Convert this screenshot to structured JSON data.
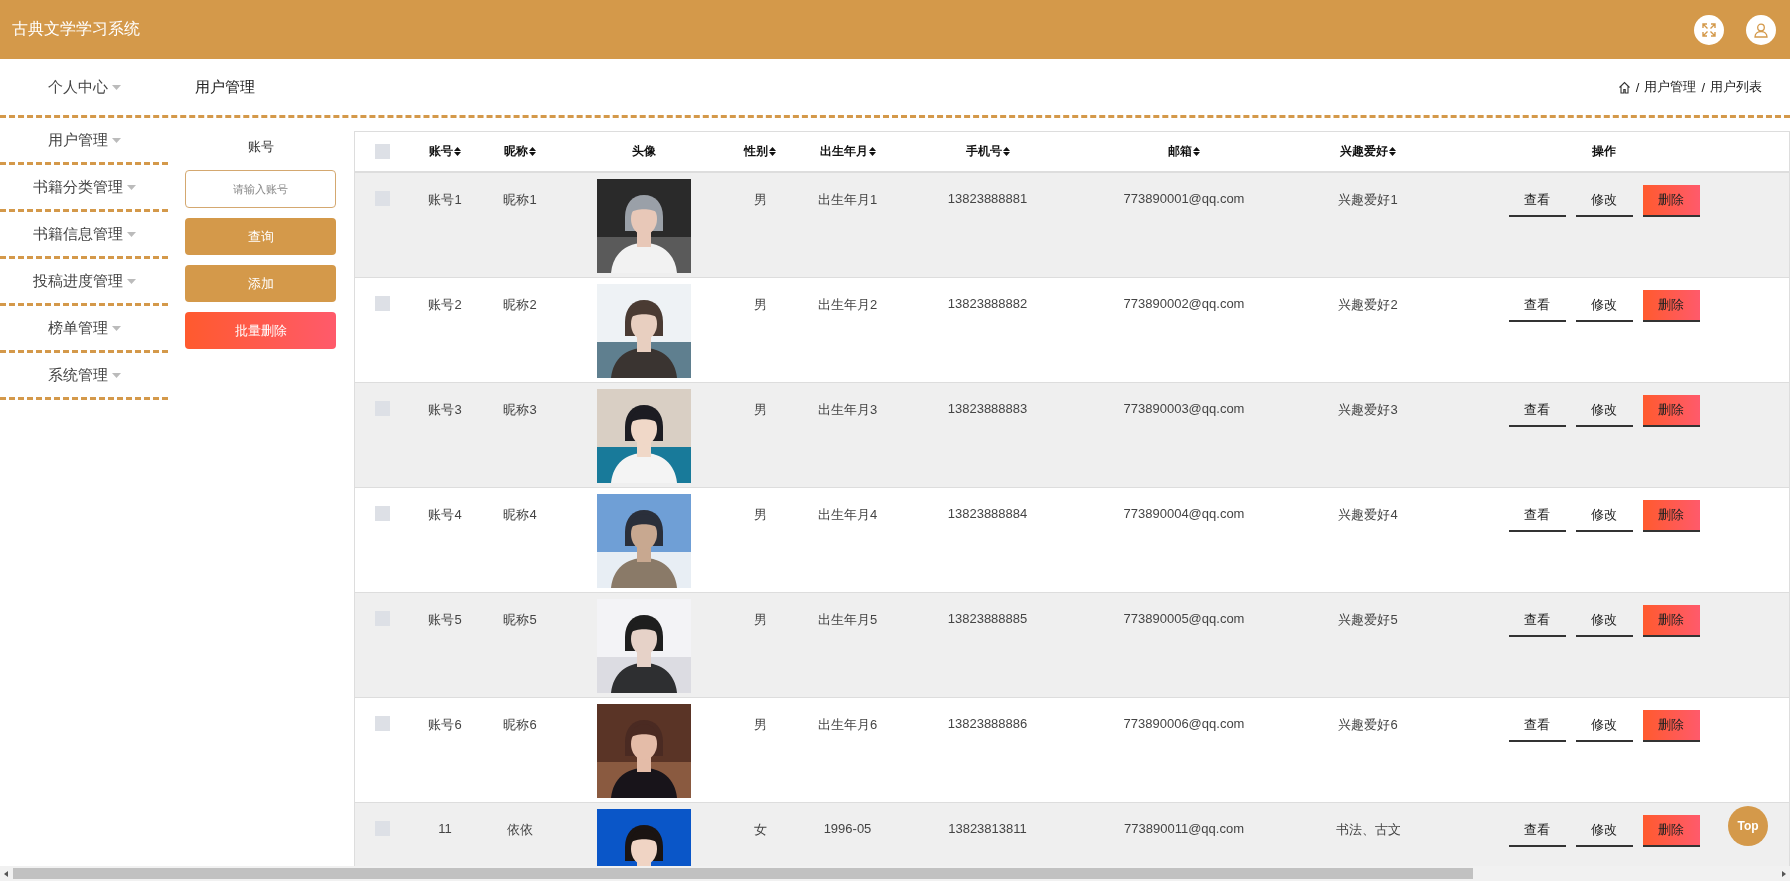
{
  "header": {
    "title": "古典文学学习系统"
  },
  "sidebar": {
    "items": [
      {
        "label": "个人中心"
      },
      {
        "label": "用户管理"
      },
      {
        "label": "书籍分类管理"
      },
      {
        "label": "书籍信息管理"
      },
      {
        "label": "投稿进度管理"
      },
      {
        "label": "榜单管理"
      },
      {
        "label": "系统管理"
      }
    ]
  },
  "page_title": "用户管理",
  "breadcrumb": {
    "separator": "/",
    "items": [
      "用户管理",
      "用户列表"
    ]
  },
  "search": {
    "label": "账号",
    "placeholder": "请输入账号",
    "buttons": [
      {
        "label": "查询",
        "kind": "primary"
      },
      {
        "label": "添加",
        "kind": "primary"
      },
      {
        "label": "批量删除",
        "kind": "danger"
      }
    ]
  },
  "table": {
    "all_checked": false,
    "columns": [
      {
        "label": "账号",
        "sortable": true
      },
      {
        "label": "昵称",
        "sortable": true
      },
      {
        "label": "头像",
        "sortable": false
      },
      {
        "label": "性别",
        "sortable": true
      },
      {
        "label": "出生年月",
        "sortable": true
      },
      {
        "label": "手机号",
        "sortable": true
      },
      {
        "label": "邮箱",
        "sortable": true
      },
      {
        "label": "兴趣爱好",
        "sortable": true
      },
      {
        "label": "操作",
        "sortable": false
      }
    ],
    "rows": [
      {
        "checked": false,
        "account": "账号1",
        "nickname": "昵称1",
        "gender": "男",
        "birth": "出生年月1",
        "phone": "13823888881",
        "email": "773890001@qq.com",
        "hobby": "兴趣爱好1",
        "actions": [
          {
            "label": "查看",
            "kind": "view"
          },
          {
            "label": "修改",
            "kind": "edit"
          },
          {
            "label": "删除",
            "kind": "delete"
          }
        ]
      },
      {
        "checked": false,
        "account": "账号2",
        "nickname": "昵称2",
        "gender": "男",
        "birth": "出生年月2",
        "phone": "13823888882",
        "email": "773890002@qq.com",
        "hobby": "兴趣爱好2",
        "actions": [
          {
            "label": "查看",
            "kind": "view"
          },
          {
            "label": "修改",
            "kind": "edit"
          },
          {
            "label": "删除",
            "kind": "delete"
          }
        ]
      },
      {
        "checked": false,
        "account": "账号3",
        "nickname": "昵称3",
        "gender": "男",
        "birth": "出生年月3",
        "phone": "13823888883",
        "email": "773890003@qq.com",
        "hobby": "兴趣爱好3",
        "actions": [
          {
            "label": "查看",
            "kind": "view"
          },
          {
            "label": "修改",
            "kind": "edit"
          },
          {
            "label": "删除",
            "kind": "delete"
          }
        ]
      },
      {
        "checked": false,
        "account": "账号4",
        "nickname": "昵称4",
        "gender": "男",
        "birth": "出生年月4",
        "phone": "13823888884",
        "email": "773890004@qq.com",
        "hobby": "兴趣爱好4",
        "actions": [
          {
            "label": "查看",
            "kind": "view"
          },
          {
            "label": "修改",
            "kind": "edit"
          },
          {
            "label": "删除",
            "kind": "delete"
          }
        ]
      },
      {
        "checked": false,
        "account": "账号5",
        "nickname": "昵称5",
        "gender": "男",
        "birth": "出生年月5",
        "phone": "13823888885",
        "email": "773890005@qq.com",
        "hobby": "兴趣爱好5",
        "actions": [
          {
            "label": "查看",
            "kind": "view"
          },
          {
            "label": "修改",
            "kind": "edit"
          },
          {
            "label": "删除",
            "kind": "delete"
          }
        ]
      },
      {
        "checked": false,
        "account": "账号6",
        "nickname": "昵称6",
        "gender": "男",
        "birth": "出生年月6",
        "phone": "13823888886",
        "email": "773890006@qq.com",
        "hobby": "兴趣爱好6",
        "actions": [
          {
            "label": "查看",
            "kind": "view"
          },
          {
            "label": "修改",
            "kind": "edit"
          },
          {
            "label": "删除",
            "kind": "delete"
          }
        ]
      },
      {
        "checked": false,
        "account": "11",
        "nickname": "依依",
        "gender": "女",
        "birth": "1996-05",
        "phone": "13823813811",
        "email": "773890011@qq.com",
        "hobby": "书法、古文",
        "actions": [
          {
            "label": "查看",
            "kind": "view"
          },
          {
            "label": "修改",
            "kind": "edit"
          },
          {
            "label": "删除",
            "kind": "delete"
          }
        ]
      }
    ]
  },
  "top_button": {
    "label": "Top"
  }
}
